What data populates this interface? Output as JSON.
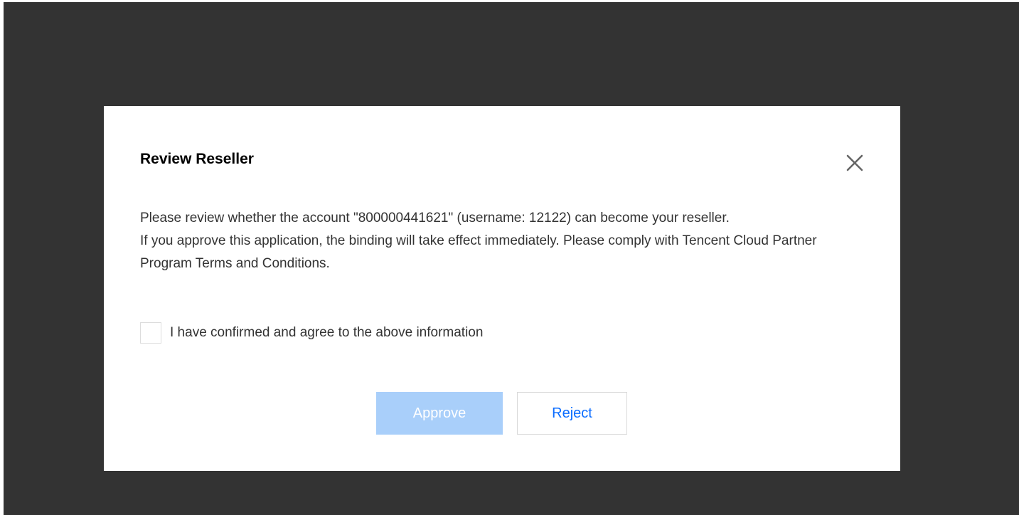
{
  "dialog": {
    "title": "Review Reseller",
    "message_line1": "Please review whether the account \"800000441621\" (username: 12122) can become your reseller.",
    "message_line2": "If you approve this application, the binding will take effect immediately. Please comply with Tencent Cloud Partner Program Terms and Conditions.",
    "agree_label": "I have confirmed and agree to the above information",
    "agree_checked": false,
    "approve_label": "Approve",
    "reject_label": "Reject",
    "close_icon": "close-icon"
  },
  "colors": {
    "overlay": "#333333",
    "approve_disabled_bg": "#a9cffa",
    "reject_text": "#0a6cff"
  }
}
